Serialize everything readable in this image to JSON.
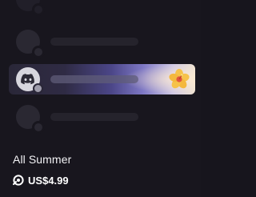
{
  "product": {
    "name": "All Summer",
    "price": "US$4.99"
  },
  "icons": {
    "price": "orb-currency-icon",
    "avatar": "discord-logo-icon",
    "decoration": "hibiscus-flower-icon"
  },
  "colors": {
    "background": "#18161e",
    "placeholder": "#2a2832",
    "text": "#f2f2f5",
    "gradient_start": "#2a2738",
    "gradient_mid": "#4b4688",
    "gradient_end": "#efe3d2"
  }
}
